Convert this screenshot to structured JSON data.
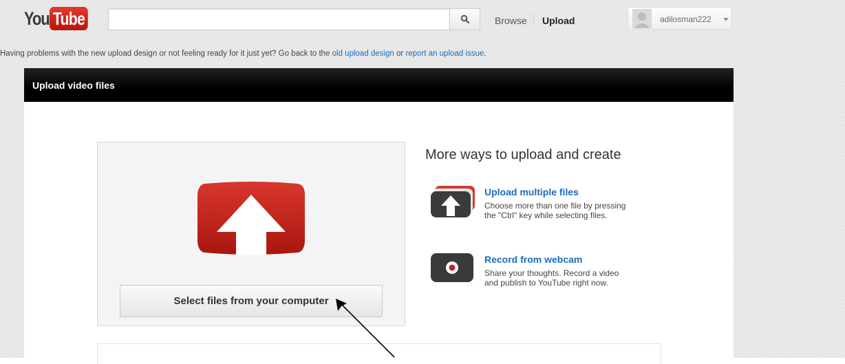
{
  "header": {
    "logo_you": "You",
    "logo_tube": "Tube",
    "search_placeholder": "",
    "nav_browse": "Browse",
    "nav_upload": "Upload",
    "username": "adilosman222"
  },
  "notice": {
    "prefix": "Having problems with the new upload design or not feeling ready for it just yet? Go back to the ",
    "link1": "old upload design",
    "middle": " or ",
    "link2": "report an upload issue",
    "suffix": "."
  },
  "panel": {
    "title": "Upload video files",
    "select_button": "Select files from your computer"
  },
  "more_ways": {
    "title": "More ways to upload and create",
    "options": [
      {
        "title": "Upload multiple files",
        "line1": "Choose more than one file by pressing",
        "line2": "the \"Ctrl\" key while selecting files."
      },
      {
        "title": "Record from webcam",
        "line1": "Share your thoughts. Record a video",
        "line2": "and publish to YouTube right now."
      }
    ]
  },
  "colors": {
    "accent_red": "#c4261d",
    "link_blue": "#1a6bbf",
    "header_black": "#000000"
  }
}
